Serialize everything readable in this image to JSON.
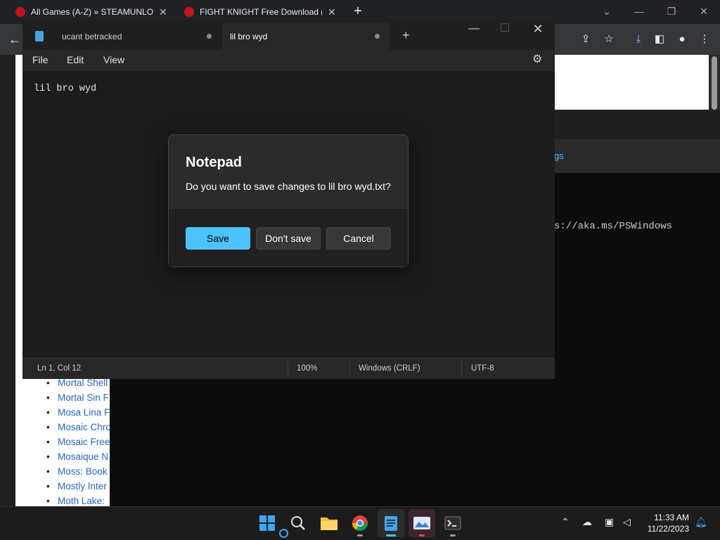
{
  "chrome": {
    "tabs": [
      {
        "title": "All Games (A-Z) » STEAMUNLOCKED",
        "close": "✕"
      },
      {
        "title": "FIGHT KNIGHT Free Download (v",
        "close": "✕"
      }
    ],
    "new_tab": "+",
    "window_controls": {
      "minimize": "—",
      "restore": "❐",
      "close": "✕",
      "tabsearch": "⌄"
    }
  },
  "web_page": {
    "game_list": [
      "Mortal Shell",
      "Mortal Sin F",
      "Mosa Lina F",
      "Mosaic Chro",
      "Mosaic Free",
      "Mosaique N",
      "Moss: Book",
      "Mostly Inter",
      "Moth Lake:"
    ]
  },
  "terminal": {
    "settings_fragment": "gs",
    "line": "s://aka.ms/PSWindows"
  },
  "notepad": {
    "tabs": [
      {
        "label": "ucant betracked",
        "active": false
      },
      {
        "label": "lil bro wyd",
        "active": true
      }
    ],
    "new_tab": "+",
    "menu": [
      "File",
      "Edit",
      "View"
    ],
    "editor_text": "lil bro wyd",
    "status": {
      "position": "Ln 1, Col 12",
      "zoom": "100%",
      "line_ending": "Windows (CRLF)",
      "encoding": "UTF-8"
    }
  },
  "dialog": {
    "title": "Notepad",
    "message": "Do you want to save changes to lil bro wyd.txt?",
    "buttons": {
      "save": "Save",
      "dont_save": "Don't save",
      "cancel": "Cancel"
    },
    "accent_color": "#4cc2ff"
  },
  "taskbar": {
    "time": "11:33 AM",
    "date": "11/22/2023"
  }
}
